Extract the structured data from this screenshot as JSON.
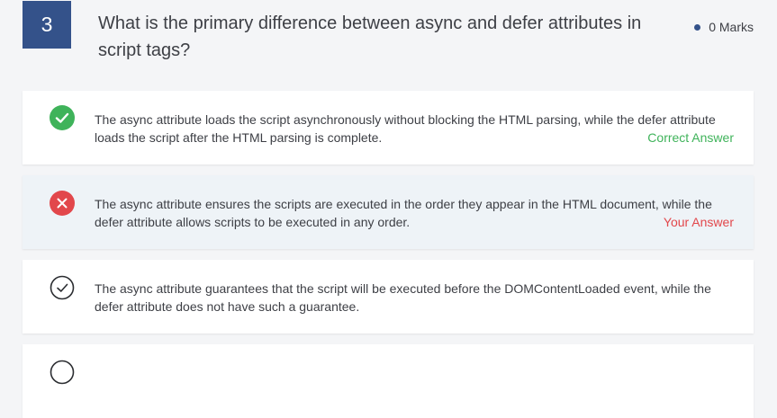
{
  "question": {
    "number": "3",
    "text": "What is the primary difference between async and defer attributes in script tags?",
    "marks": "0 Marks"
  },
  "options": [
    {
      "text": "The async attribute loads the script asynchronously without blocking the HTML parsing, while the defer attribute loads the script after the HTML parsing is complete.",
      "status": "correct",
      "icon": "check-circle-filled-icon",
      "tag": "Correct Answer"
    },
    {
      "text": "The async attribute ensures the scripts are executed in the order they appear in the HTML document, while the defer attribute allows scripts to be executed in any order.",
      "status": "selected-wrong",
      "icon": "x-circle-filled-icon",
      "tag": "Your Answer"
    },
    {
      "text": "The async attribute guarantees that the script will be executed before the DOMContentLoaded event, while the defer attribute does not have such a guarantee.",
      "status": "neutral",
      "icon": "check-circle-outline-icon",
      "tag": ""
    },
    {
      "text": "",
      "status": "neutral",
      "icon": "check-circle-outline-icon",
      "tag": ""
    }
  ],
  "colors": {
    "accent": "#34528a",
    "correct": "#3fb35a",
    "wrong": "#e2474b",
    "wrong_bg": "#eef3f7"
  }
}
